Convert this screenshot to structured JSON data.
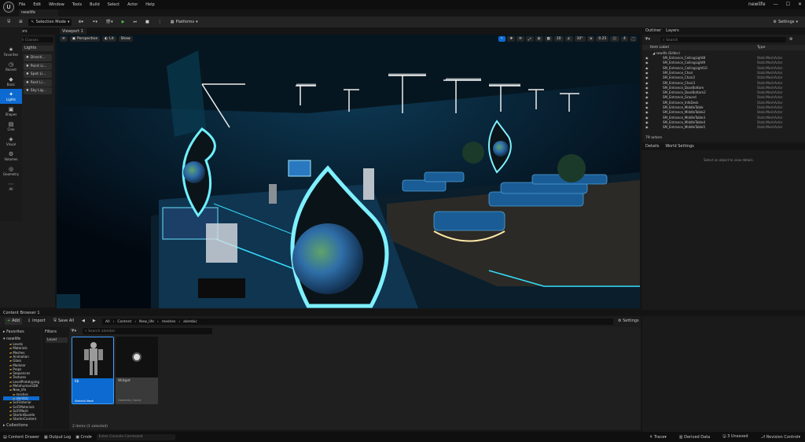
{
  "app": {
    "title": "newlife",
    "project_tab": "newlife",
    "logo": "U"
  },
  "menu": [
    "File",
    "Edit",
    "Window",
    "Tools",
    "Build",
    "Select",
    "Actor",
    "Help"
  ],
  "toolbar": {
    "mode": "Selection Mode",
    "platforms": "Platforms",
    "settings": "Settings"
  },
  "modes": [
    {
      "icon": "★",
      "label": "Favorites"
    },
    {
      "icon": "◷",
      "label": "Recent"
    },
    {
      "icon": "◆",
      "label": "Basic"
    },
    {
      "icon": "✦",
      "label": "Lights"
    },
    {
      "icon": "▣",
      "label": "Shapes"
    },
    {
      "icon": "▤",
      "label": "Cine"
    },
    {
      "icon": "◈",
      "label": "Visual"
    },
    {
      "icon": "⚙",
      "label": "Volumes"
    },
    {
      "icon": "◎",
      "label": "Geometry"
    },
    {
      "icon": "⋯",
      "label": "All"
    }
  ],
  "place_actors": {
    "tab": "Place Actors",
    "search_placeholder": "Search Classes",
    "category": "Lights",
    "items": [
      "Directi...",
      "Point Li...",
      "Spot Li...",
      "Rect Li...",
      "Sky Lig..."
    ]
  },
  "viewport": {
    "tab": "Viewport 1",
    "perspective": "Perspective",
    "lit": "Lit",
    "show": "Show",
    "grid": "10",
    "angle": "10°",
    "scale": "0.25",
    "cam": "4"
  },
  "outliner": {
    "tabs": [
      "Outliner",
      "Layers"
    ],
    "search_placeholder": "Search",
    "col_label": "Item Label",
    "col_type": "Type",
    "root": "newlife (Editor)",
    "rows": [
      "SM_Entrance_CeilingLight8",
      "SM_Entrance_CeilingLight9",
      "SM_Entrance_CeilingLight10",
      "SM_Entrance_Chair",
      "SM_Entrance_Chair2",
      "SM_Entrance_Chair3",
      "SM_Entrance_DoorBottom",
      "SM_Entrance_DoorBottom2",
      "SM_Entrance_Ground",
      "SM_Entrance_InfoDesk",
      "SM_Entrance_MiddleTable",
      "SM_Entrance_MiddleTable2",
      "SM_Entrance_MiddleTable3",
      "SM_Entrance_MiddleTable4",
      "SM_Entrance_MiddleTable5"
    ],
    "row_type": "StaticMeshActor",
    "count": "79 actors"
  },
  "details": {
    "tabs": [
      "Details",
      "World Settings"
    ],
    "empty": "Select an object to view details."
  },
  "content_browser": {
    "tab": "Content Browser 1",
    "add": "Add",
    "import": "Import",
    "save_all": "Save All",
    "settings": "Settings",
    "path": [
      "All",
      "Content",
      "New_life",
      "meshes",
      "alembic"
    ],
    "search_placeholder": "Search alembic",
    "favorites": "Favorites",
    "root": "newlife",
    "filters": "Filters",
    "filter_item": "Level",
    "tree": [
      "Levels",
      "Materials",
      "Meshes",
      "Animation",
      "Glass",
      "Modular",
      "Props",
      "Sequences",
      "Textures",
      "LevelPrototyping",
      "MetahumanSDK",
      "New_life",
      "meshes",
      "alembic",
      "SciFiInterior",
      "SciFiMaterials",
      "SciFiMesh",
      "StarterBundle",
      "StarterContent"
    ],
    "collections": "Collections",
    "assets": [
      {
        "name": "lib",
        "type": "Skeletal Mesh"
      },
      {
        "name": "Widget",
        "type": "Geometry Cache"
      }
    ],
    "count": "2 items (1 selected)"
  },
  "status": {
    "content_drawer": "Content Drawer",
    "output_log": "Output Log",
    "cmd": "Cmd",
    "cmd_placeholder": "Enter Console Command",
    "trace": "Trace",
    "derived": "Derived Data",
    "unsaved": "3 Unsaved",
    "revision": "Revision Control"
  },
  "colors": {
    "accent": "#0d6ad1",
    "neon": "#35e0ff",
    "bg": "#151515"
  }
}
